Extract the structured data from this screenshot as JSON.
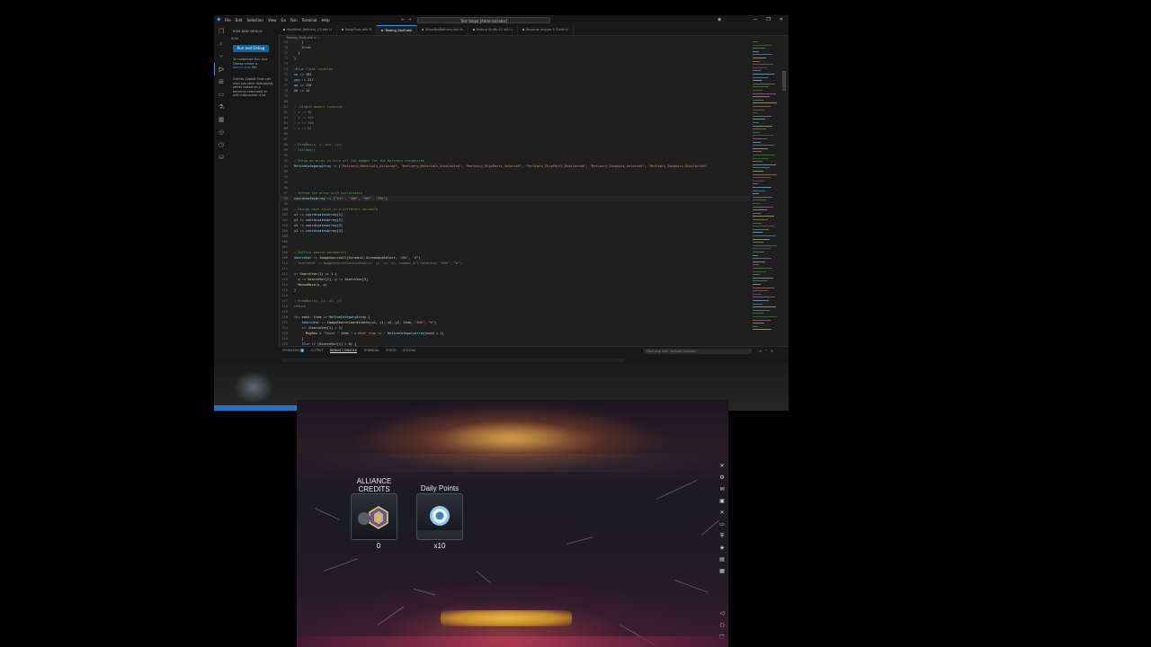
{
  "vscode": {
    "menu": [
      "File",
      "Edit",
      "Selection",
      "View",
      "Go",
      "Run",
      "Terminal",
      "Help"
    ],
    "search": "Test Steps [Administrator]",
    "window_controls": [
      "—",
      "❐",
      "✕"
    ],
    "sidebar": {
      "title": "RUN AND DEBUG",
      "subtitle": "RUN",
      "run_button": "Run and Debug",
      "text1": "To customize Run and Debug create a",
      "link1": "launch.json",
      "text1b": "file.",
      "text2": "GitHub Copilot Chat can help you start debugging, either based on a terminal command or with interactive chat."
    },
    "tabs": [
      {
        "label": "StarSteal_Refinery_V2.ahk  U",
        "active": false,
        "color": "#e2c08d"
      },
      {
        "label": "DailyFinds.ahk  M",
        "active": false,
        "color": "#e2c08d"
      },
      {
        "label": "Testing_Stuff.ahk",
        "active": true,
        "color": "#e2c08d"
      },
      {
        "label": "MinerBotRefinery.ahk  M",
        "active": false,
        "color": "#73c991"
      },
      {
        "label": "Testing Stuffs V2.ahk  U",
        "active": false,
        "color": "#e2c08d"
      },
      {
        "label": "Rewards images 1-3.ahk  U",
        "active": false,
        "color": "#e2c08d"
      }
    ],
    "breadcrumb": "Testing_Stuff.ahk > ...",
    "panel": {
      "tabs": [
        "PROBLEMS",
        "OUTPUT",
        "DEBUG CONSOLE",
        "TERMINAL",
        "PORTS",
        "GITLENS"
      ],
      "problems_count": "1",
      "active_tab": "DEBUG CONSOLE",
      "filter_placeholder": "Filter (e.g. text, !exclude, \\escape)"
    },
    "lines": [
      {
        "n": "69",
        "parts": [
          [
            "c-op",
            "    }"
          ]
        ]
      },
      {
        "n": "70",
        "parts": [
          [
            "c-kw",
            "    Break"
          ]
        ]
      },
      {
        "n": "71",
        "parts": [
          [
            "c-op",
            "  }"
          ]
        ]
      },
      {
        "n": "72",
        "parts": [
          [
            "c-op",
            "}"
          ]
        ]
      },
      {
        "n": "73",
        "parts": [
          [
            "c-op",
            ""
          ]
        ]
      },
      {
        "n": "74",
        "parts": [
          [
            "c-cm",
            ";Blue Claim location"
          ]
        ]
      },
      {
        "n": "75",
        "parts": [
          [
            "c-var",
            "xx"
          ],
          [
            "c-op",
            " := "
          ],
          [
            "c-num",
            "783"
          ]
        ]
      },
      {
        "n": "76",
        "parts": [
          [
            "c-var",
            "yyy"
          ],
          [
            "c-op",
            " := "
          ],
          [
            "c-num",
            "217"
          ]
        ]
      },
      {
        "n": "77",
        "parts": [
          [
            "c-var",
            "ww"
          ],
          [
            "c-op",
            " := "
          ],
          [
            "c-num",
            "136"
          ]
        ]
      },
      {
        "n": "78",
        "parts": [
          [
            "c-var",
            "hh"
          ],
          [
            "c-op",
            " := "
          ],
          [
            "c-num",
            "14"
          ]
        ]
      },
      {
        "n": "79",
        "parts": [
          [
            "c-op",
            ""
          ]
        ]
      },
      {
        "n": "80",
        "parts": [
          [
            "c-op",
            ""
          ]
        ]
      },
      {
        "n": "81",
        "parts": [
          [
            "c-cm",
            "; ;Single amount location"
          ]
        ]
      },
      {
        "n": "82",
        "parts": [
          [
            "c-cm",
            "; x := 98"
          ]
        ]
      },
      {
        "n": "83",
        "parts": [
          [
            "c-cm",
            "; y := 432"
          ]
        ]
      },
      {
        "n": "84",
        "parts": [
          [
            "c-cm",
            "; w := 398"
          ]
        ]
      },
      {
        "n": "85",
        "parts": [
          [
            "c-cm",
            "; h := 32"
          ]
        ]
      },
      {
        "n": "86",
        "parts": [
          [
            "c-op",
            ""
          ]
        ]
      },
      {
        "n": "87",
        "parts": [
          [
            "c-op",
            ""
          ]
        ]
      },
      {
        "n": "88",
        "parts": [
          [
            "c-cm",
            "; DrawBox(x, y, xxx, yyy)"
          ]
        ]
      },
      {
        "n": "89",
        "parts": [
          [
            "c-cm",
            "; ExitApp()"
          ]
        ]
      },
      {
        "n": "90",
        "parts": [
          [
            "c-op",
            ""
          ]
        ]
      },
      {
        "n": "91",
        "parts": [
          [
            "c-cm",
            "; Setup an array to hold all the images for the Refinery categories"
          ]
        ]
      },
      {
        "n": "92",
        "parts": [
          [
            "c-var",
            "RefineCategoryArray"
          ],
          [
            "c-op",
            " := ["
          ],
          [
            "c-str",
            "\"Refinery_Materials_Selected\""
          ],
          [
            "c-op",
            ", "
          ],
          [
            "c-str",
            "\"Refinery_Materials_Unselected\""
          ],
          [
            "c-op",
            ", "
          ],
          [
            "c-str",
            "\"Refinery_ShipParts_Selected\""
          ],
          [
            "c-op",
            ", "
          ],
          [
            "c-str",
            "\"Refinery_ShipParts_Unselected\""
          ],
          [
            "c-op",
            ", "
          ],
          [
            "c-str",
            "\"Refinery_Outposts_Selected\""
          ],
          [
            "c-op",
            ", "
          ],
          [
            "c-str",
            "\"Refinery_Outposts_Unselected\""
          ]
        ]
      },
      {
        "n": "93",
        "parts": [
          [
            "c-op",
            ""
          ]
        ]
      },
      {
        "n": "94",
        "parts": [
          [
            "c-op",
            ""
          ]
        ]
      },
      {
        "n": "95",
        "parts": [
          [
            "c-op",
            ""
          ]
        ]
      },
      {
        "n": "96",
        "parts": [
          [
            "c-op",
            ""
          ]
        ]
      },
      {
        "n": "97",
        "parts": [
          [
            "c-cm",
            "; Define the array with coordinates"
          ]
        ]
      },
      {
        "n": "98",
        "parts": [
          [
            "c-var",
            "coordinatesArray"
          ],
          [
            "c-op",
            " := ["
          ],
          [
            "c-str",
            "\"541\""
          ],
          [
            "c-op",
            ", "
          ],
          [
            "c-str",
            "\"356\""
          ],
          [
            "c-op",
            ", "
          ],
          [
            "c-str",
            "\"983\""
          ],
          [
            "c-op",
            ", "
          ],
          [
            "c-str",
            "\"390\""
          ],
          [
            "c-op",
            "]"
          ]
        ]
      },
      {
        "n": "99",
        "parts": [
          [
            "c-op",
            ""
          ]
        ]
      },
      {
        "n": "100",
        "parts": [
          [
            "c-cm",
            "; Assign each value to a different variable"
          ]
        ]
      },
      {
        "n": "101",
        "parts": [
          [
            "c-var",
            "x1"
          ],
          [
            "c-op",
            " := "
          ],
          [
            "c-var",
            "coordinatesArray"
          ],
          [
            "c-op",
            "[1]"
          ]
        ]
      },
      {
        "n": "102",
        "parts": [
          [
            "c-var",
            "y1"
          ],
          [
            "c-op",
            " := "
          ],
          [
            "c-var",
            "coordinatesArray"
          ],
          [
            "c-op",
            "[2]"
          ]
        ]
      },
      {
        "n": "103",
        "parts": [
          [
            "c-var",
            "x2"
          ],
          [
            "c-op",
            " := "
          ],
          [
            "c-var",
            "coordinatesArray"
          ],
          [
            "c-op",
            "[3]"
          ]
        ]
      },
      {
        "n": "104",
        "parts": [
          [
            "c-var",
            "y2"
          ],
          [
            "c-op",
            " := "
          ],
          [
            "c-var",
            "coordinatesArray"
          ],
          [
            "c-op",
            "[4]"
          ]
        ]
      },
      {
        "n": "105",
        "parts": [
          [
            "c-op",
            ""
          ]
        ]
      },
      {
        "n": "106",
        "parts": [
          [
            "c-op",
            ""
          ]
        ]
      },
      {
        "n": "107",
        "parts": [
          [
            "c-op",
            ""
          ]
        ]
      },
      {
        "n": "108",
        "parts": [
          [
            "c-cm",
            "; OnClick search parameters"
          ]
        ]
      },
      {
        "n": "109",
        "parts": [
          [
            "c-var",
            "SearchVar"
          ],
          [
            "c-op",
            " := "
          ],
          [
            "c-fn",
            "ImageSearchAll"
          ],
          [
            "c-op",
            "(Screens\\.ScreenAndSelect, "
          ],
          [
            "c-str",
            "\"AHK\""
          ],
          [
            "c-op",
            ", "
          ],
          [
            "c-str",
            "\"W\""
          ],
          [
            "c-op",
            ")"
          ]
        ]
      },
      {
        "n": "110",
        "parts": [
          [
            "c-cm",
            "; SearchVar := ImageSearchCoordinates(x1, y1, x2, y2, Summon_All_Selected, \"AHK\", \"W\")"
          ]
        ]
      },
      {
        "n": "111",
        "parts": [
          [
            "c-op",
            ""
          ]
        ]
      },
      {
        "n": "112",
        "parts": [
          [
            "c-kw",
            "if"
          ],
          [
            "c-op",
            " SearchVar[1] == 1 {"
          ]
        ]
      },
      {
        "n": "113",
        "parts": [
          [
            "c-op",
            "  x := SearchVar[2], y := SearchVar[3]"
          ]
        ]
      },
      {
        "n": "114",
        "parts": [
          [
            "c-fn",
            "  MouseMove"
          ],
          [
            "c-op",
            "(x, y)"
          ]
        ]
      },
      {
        "n": "115",
        "parts": [
          [
            "c-op",
            "}"
          ]
        ]
      },
      {
        "n": "116",
        "parts": [
          [
            "c-op",
            ""
          ]
        ]
      },
      {
        "n": "117",
        "parts": [
          [
            "c-cm",
            "; DrawBox(x1, y1, x2, y2)"
          ]
        ]
      },
      {
        "n": "118",
        "parts": [
          [
            "c-kw",
            "return"
          ]
        ]
      },
      {
        "n": "119",
        "parts": [
          [
            "c-op",
            ""
          ]
        ]
      },
      {
        "n": "120",
        "parts": [
          [
            "c-kw",
            "for"
          ],
          [
            "c-op",
            " each, item "
          ],
          [
            "c-kw",
            "in"
          ],
          [
            "c-var",
            " RefineCategoryArray"
          ],
          [
            "c-op",
            " {"
          ]
        ]
      },
      {
        "n": "121",
        "parts": [
          [
            "c-var",
            "    SearchVar"
          ],
          [
            "c-op",
            " := "
          ],
          [
            "c-fn",
            "ImageSearchCoordinates"
          ],
          [
            "c-op",
            "(x1, y1, x2, y2, item, "
          ],
          [
            "c-str",
            "\"AHK\""
          ],
          [
            "c-op",
            ", "
          ],
          [
            "c-str",
            "\"W\""
          ],
          [
            "c-op",
            ")"
          ]
        ]
      },
      {
        "n": "122",
        "parts": [
          [
            "c-kw",
            "    if"
          ],
          [
            "c-op",
            " (SearchVar[1] = 1)"
          ]
        ]
      },
      {
        "n": "123",
        "parts": [
          [
            "c-fn",
            "      MsgBox"
          ],
          [
            "c-op",
            " % "
          ],
          [
            "c-str",
            "\"Found \""
          ],
          [
            "c-op",
            " item "
          ],
          [
            "c-str",
            "\" a Next item is \""
          ],
          [
            "c-var",
            " RefineCategoryArray"
          ],
          [
            "c-op",
            "[each + 1]"
          ]
        ]
      },
      {
        "n": "124",
        "parts": [
          [
            "c-op",
            "    }"
          ]
        ]
      },
      {
        "n": "125",
        "parts": [
          [
            "c-kw",
            "    Else if"
          ],
          [
            "c-op",
            " (SearchVar[1] = 0) {"
          ]
        ]
      },
      {
        "n": "126",
        "parts": [
          [
            "c-fn",
            "      MsgBox"
          ],
          [
            "c-op",
            " % "
          ],
          [
            "c-str",
            "\"Not Found \""
          ],
          [
            "c-op",
            " item "
          ],
          [
            "c-str",
            "\" Next item is \""
          ],
          [
            "c-var",
            " RefineCategoryArray"
          ],
          [
            "c-op",
            "[each + 1]"
          ]
        ]
      },
      {
        "n": "127",
        "parts": [
          [
            "c-op",
            "    }"
          ]
        ]
      },
      {
        "n": "128",
        "parts": [
          [
            "c-op",
            ""
          ]
        ]
      }
    ]
  },
  "game": {
    "rewards": [
      {
        "label": "ALLIANCE CREDITS",
        "quantity": "0",
        "icon": "alliance-credits-icon"
      },
      {
        "label": "Daily Points",
        "quantity": "x10",
        "icon": "daily-points-icon"
      }
    ],
    "side_icons": [
      "close-icon",
      "settings-icon",
      "mail-icon",
      "inventory-icon",
      "cross-icon",
      "chat-icon",
      "alliance-icon",
      "event-icon",
      "trash-icon",
      "calendar-icon",
      "back-icon",
      "home-icon",
      "square-icon"
    ]
  }
}
